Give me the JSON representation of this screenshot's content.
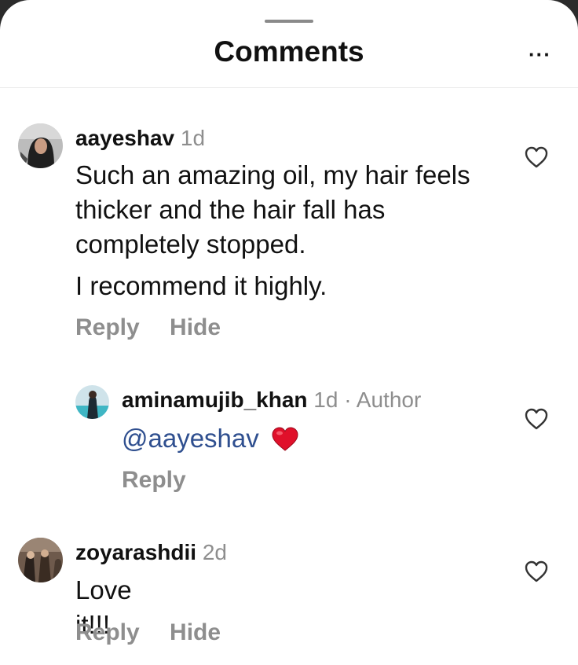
{
  "header": {
    "title": "Comments",
    "more_label": "···"
  },
  "comments": [
    {
      "username": "aayeshav",
      "time": "1d",
      "paragraphs": [
        "Such an amazing oil, my hair feels thicker and the hair fall has completely stopped.",
        "I recommend it highly."
      ],
      "reply_label": "Reply",
      "hide_label": "Hide",
      "icon": "heart-outline-icon"
    },
    {
      "username": "aminamujib_khan",
      "time": "1d",
      "author_badge": "· Author",
      "mention": "@aayeshav",
      "emoji": "❤️",
      "reply_label": "Reply",
      "icon": "heart-outline-icon"
    },
    {
      "username": "zoyarashdii",
      "time": "2d",
      "text": "Love it!!!",
      "reply_label": "Reply",
      "hide_label": "Hide",
      "icon": "heart-outline-icon"
    }
  ],
  "colors": {
    "text": "#111111",
    "muted": "#8e8e8e",
    "mention": "#2f4f8f",
    "heart_emoji": "#e0102a"
  }
}
